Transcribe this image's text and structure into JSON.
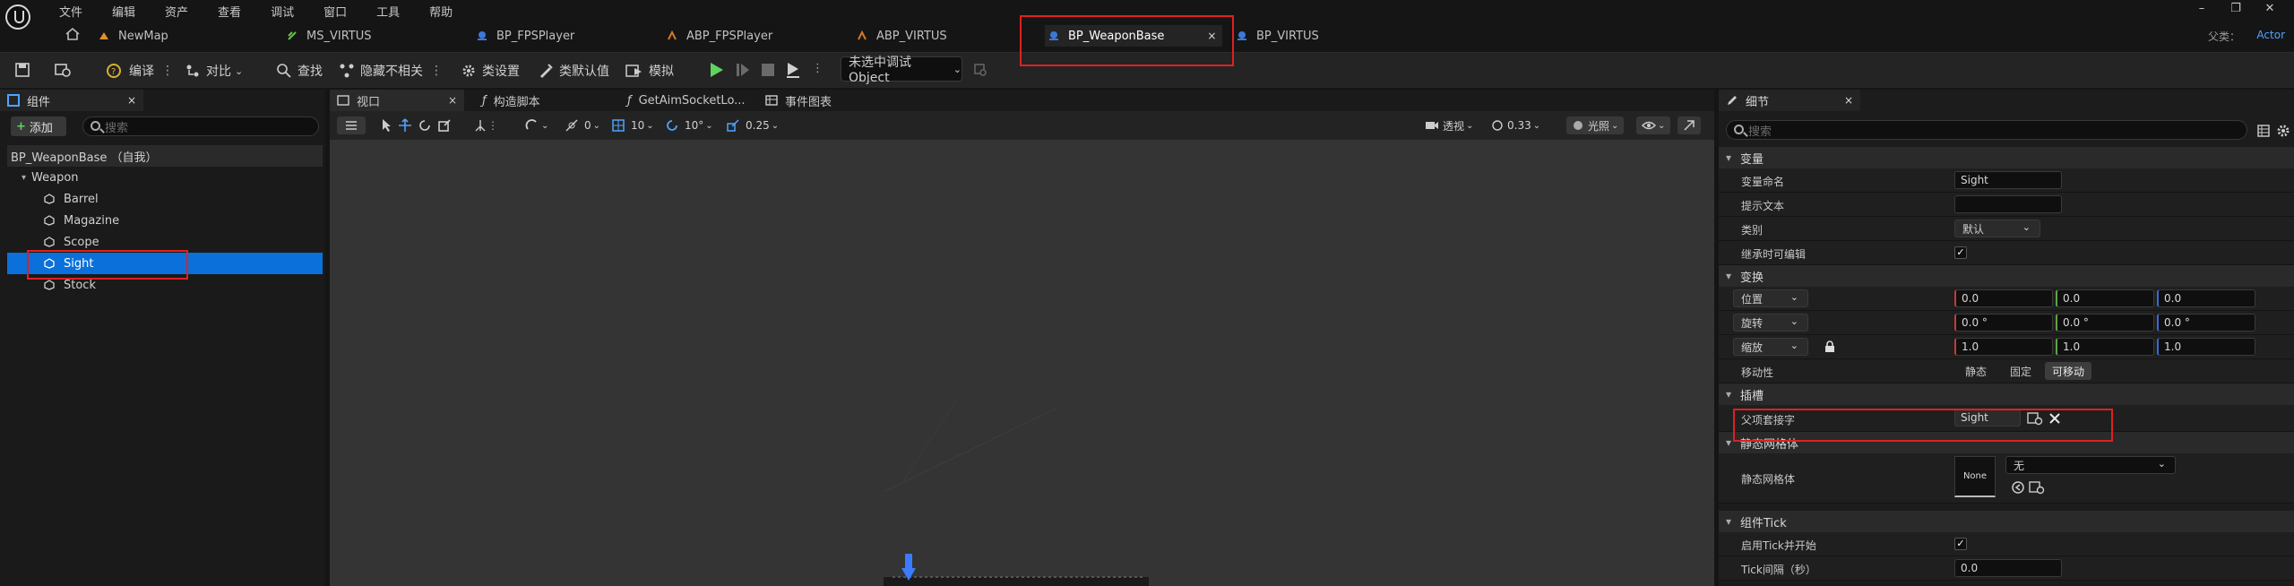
{
  "menu": [
    "文件",
    "编辑",
    "资产",
    "查看",
    "调试",
    "窗口",
    "工具",
    "帮助"
  ],
  "tabs": [
    {
      "label": "NewMap"
    },
    {
      "label": "MS_VIRTUS"
    },
    {
      "label": "BP_FPSPlayer"
    },
    {
      "label": "ABP_FPSPlayer"
    },
    {
      "label": "ABP_VIRTUS"
    },
    {
      "label": "BP_WeaponBase"
    },
    {
      "label": "BP_VIRTUS"
    }
  ],
  "tab_close": "×",
  "window_controls": [
    "–",
    "❐",
    "✕"
  ],
  "parent_class": {
    "label": "父类：",
    "value": "Actor"
  },
  "toolbar": {
    "compile": "编译",
    "diff": "对比",
    "find": "查找",
    "hide_unrelated": "隐藏不相关",
    "class_settings": "类设置",
    "class_defaults": "类默认值",
    "simulate": "模拟",
    "debug_object": "未选中调试Object"
  },
  "components_panel": {
    "tab": "组件",
    "close": "×",
    "add": "添加",
    "search_placeholder": "搜索",
    "root": "BP_WeaponBase （自我）",
    "parent": "Weapon",
    "children": [
      "Barrel",
      "Magazine",
      "Scope",
      "Sight",
      "Stock"
    ],
    "selected": "Sight"
  },
  "viewport": {
    "tabs": [
      "视口",
      "构造脚本",
      "GetAimSocketLo...",
      "事件图表"
    ],
    "grid_snap": "10",
    "rot_snap": "10°",
    "scale_snap": "0.25",
    "rot_zero": "0",
    "perspective": "透视",
    "fov": "0.33",
    "lit": "光照"
  },
  "details": {
    "tab": "细节",
    "search_placeholder": "搜索",
    "categories": {
      "variable": "变量",
      "transform": "变换",
      "sockets": "插槽",
      "static_mesh": "静态网格体",
      "component_tick": "组件Tick"
    },
    "variable_name_label": "变量命名",
    "variable_name": "Sight",
    "tooltip_label": "提示文本",
    "tooltip_value": "",
    "category_label": "类别",
    "category_value": "默认",
    "editable_when_inherited": "继承时可编辑",
    "location": {
      "label": "位置",
      "x": "0.0",
      "y": "0.0",
      "z": "0.0"
    },
    "rotation": {
      "label": "旋转",
      "x": "0.0 °",
      "y": "0.0 °",
      "z": "0.0 °"
    },
    "scale": {
      "label": "缩放",
      "x": "1.0",
      "y": "1.0",
      "z": "1.0"
    },
    "mobility_label": "移动性",
    "mobility_options": [
      "静态",
      "固定",
      "可移动"
    ],
    "mobility_selected": "可移动",
    "parent_socket_label": "父项套接字",
    "parent_socket_value": "Sight",
    "static_mesh_label": "静态网格体",
    "static_mesh_thumb": "None",
    "static_mesh_value": "无",
    "start_with_tick_label": "启用Tick并开始",
    "tick_interval_label": "Tick间隔（秒）",
    "tick_interval_value": "0.0"
  },
  "colors": {
    "selection": "#0b70d9",
    "highlight_box": "#e02020",
    "play_green": "#5fd35f",
    "accent_link": "#4fa3ff"
  }
}
